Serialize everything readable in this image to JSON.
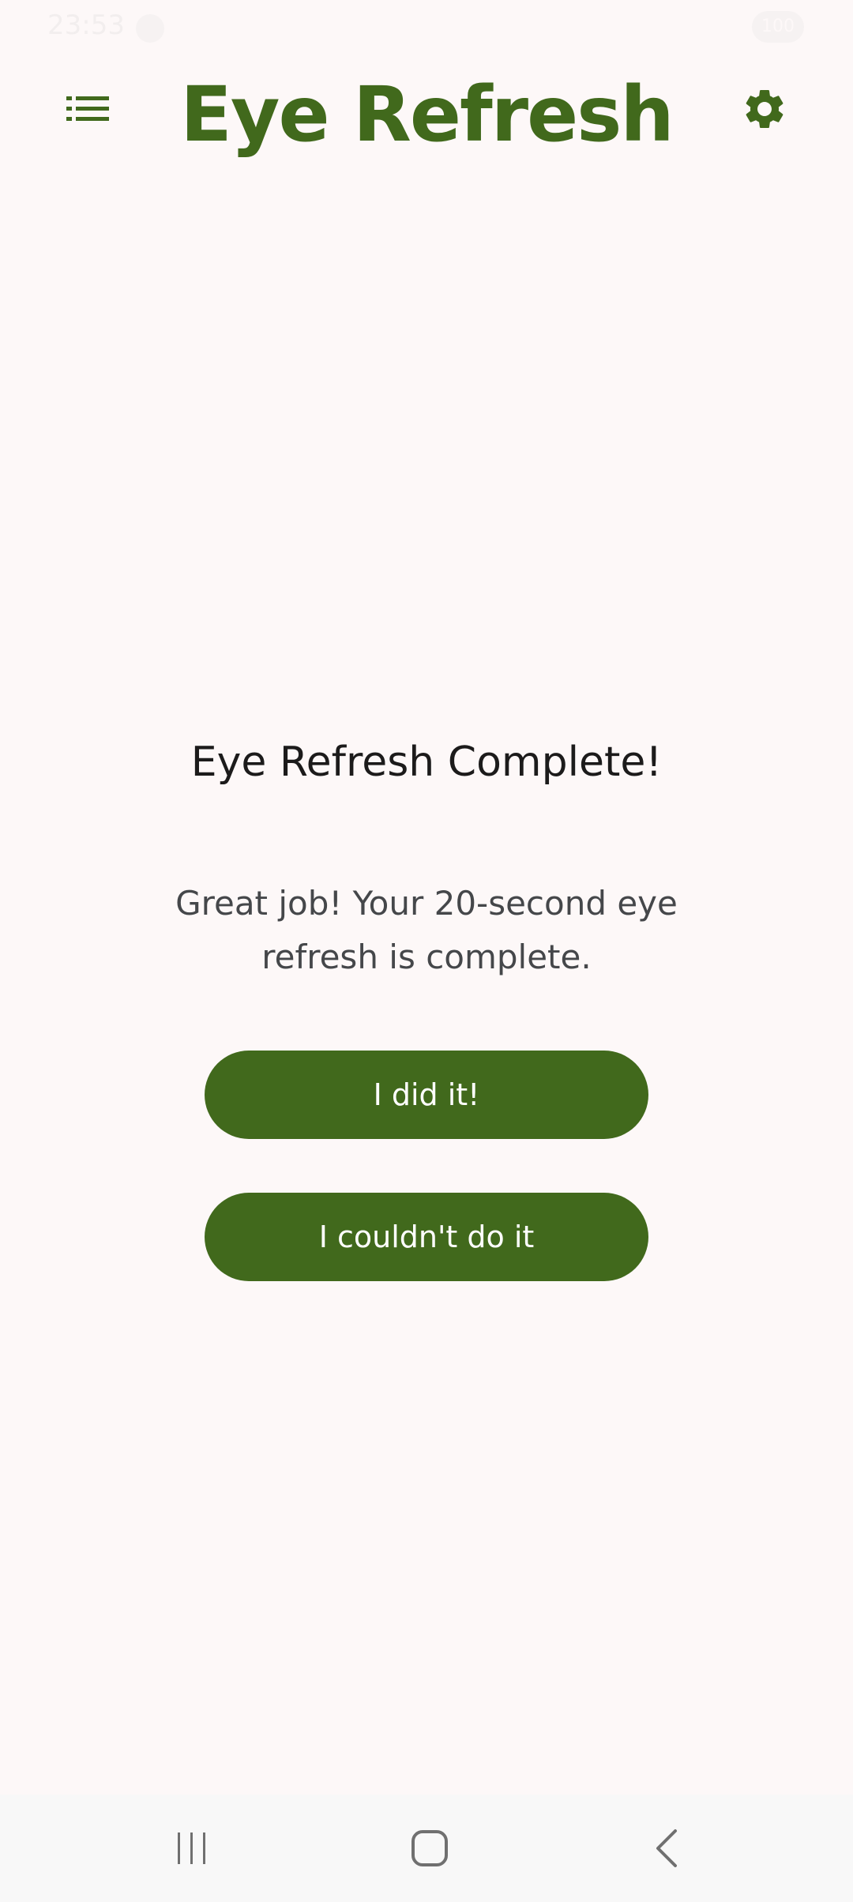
{
  "status_bar": {
    "time": "23:53",
    "battery": "100"
  },
  "app_bar": {
    "title": "Eye Refresh",
    "menu_icon": "list-icon",
    "settings_icon": "gear-icon"
  },
  "content": {
    "headline": "Eye Refresh Complete!",
    "message": "Great job! Your 20-second eye refresh is complete."
  },
  "actions": {
    "did_it_label": "I did it!",
    "couldnt_label": "I couldn't do it"
  },
  "nav_bar": {
    "recents_icon": "recents-icon",
    "home_icon": "home-icon",
    "back_icon": "back-icon"
  },
  "colors": {
    "primary": "#41691c",
    "background": "#fdf8f8",
    "on_primary": "#ffffff",
    "headline": "#1c1b1b",
    "body": "#45474a"
  }
}
